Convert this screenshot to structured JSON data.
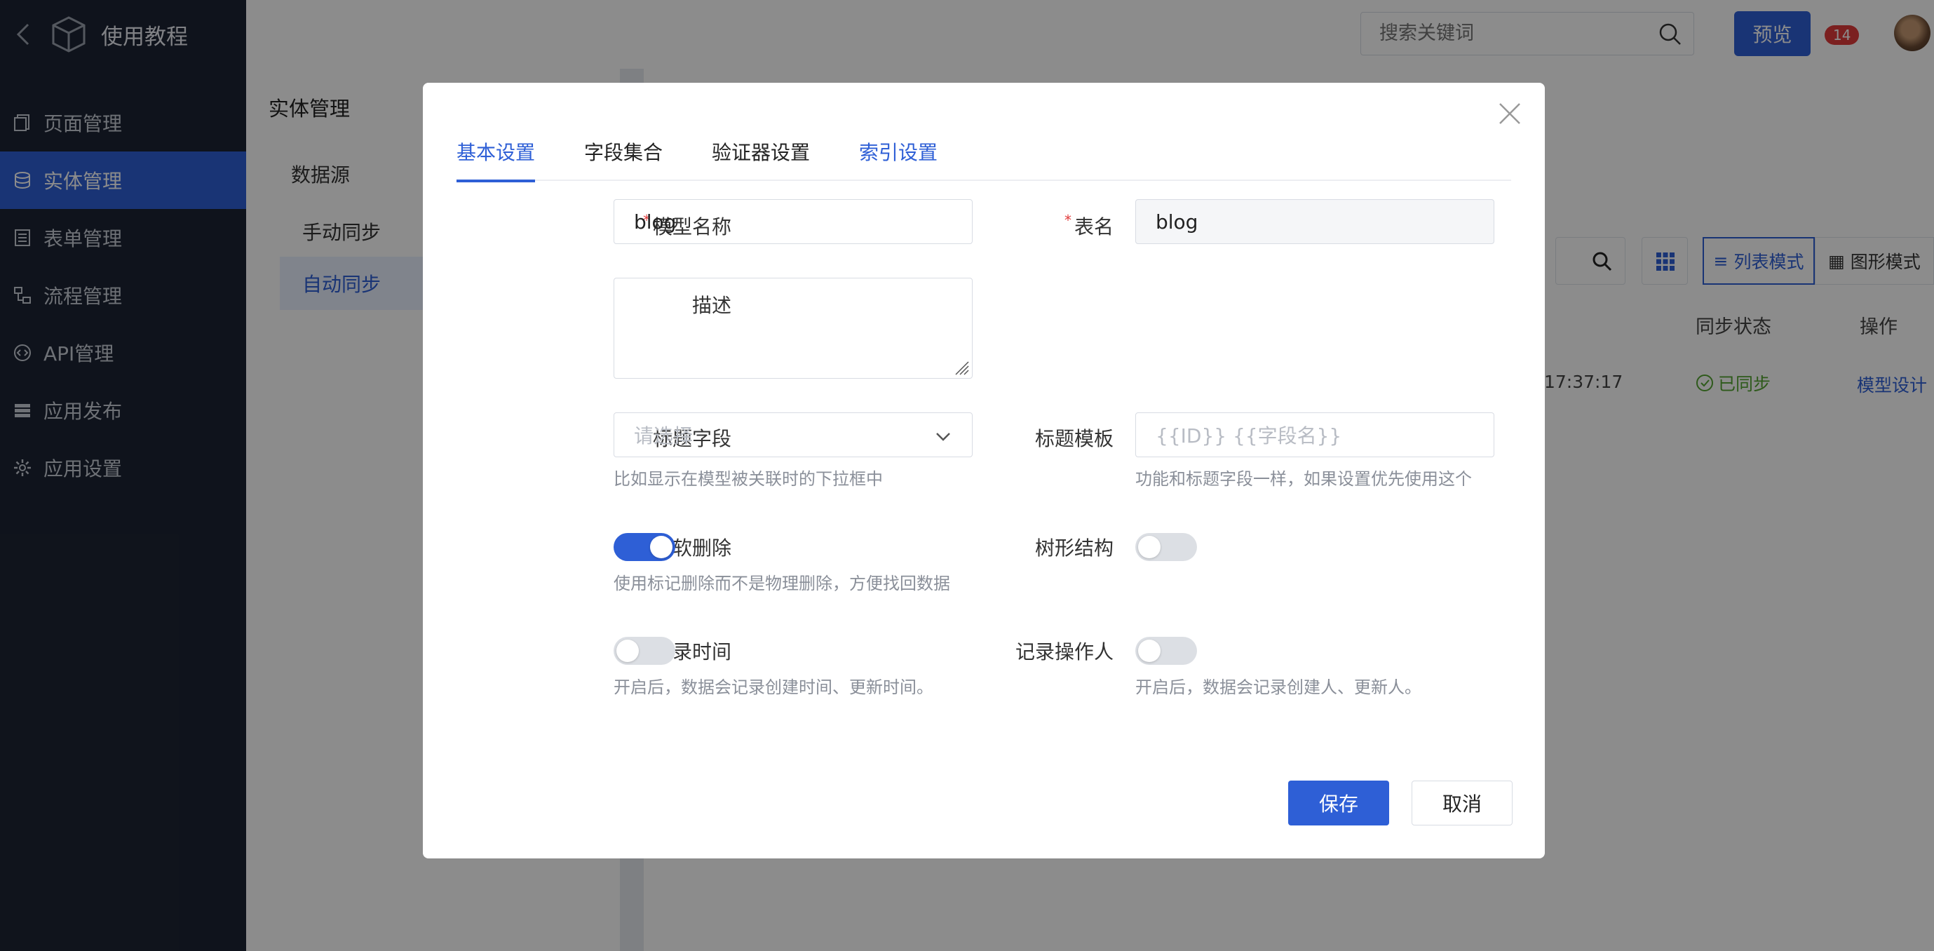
{
  "app": {
    "title": "使用教程"
  },
  "sidebar": {
    "items": [
      {
        "label": "页面管理",
        "icon": "pages-icon"
      },
      {
        "label": "实体管理",
        "icon": "database-icon",
        "active": true
      },
      {
        "label": "表单管理",
        "icon": "form-icon"
      },
      {
        "label": "流程管理",
        "icon": "flow-icon"
      },
      {
        "label": "API管理",
        "icon": "api-icon"
      },
      {
        "label": "应用发布",
        "icon": "publish-icon"
      },
      {
        "label": "应用设置",
        "icon": "gear-icon"
      }
    ]
  },
  "topbar": {
    "search_placeholder": "搜索关键词",
    "preview_label": "预览",
    "badge_count": "14"
  },
  "entity_panel": {
    "title": "实体管理",
    "datasource_label": "数据源",
    "manual_sync": "手动同步",
    "auto_sync": "自动同步"
  },
  "content": {
    "mode_list": "列表模式",
    "mode_graph": "图形模式",
    "col_sync_status": "同步状态",
    "col_action": "操作",
    "row": {
      "time": "17:37:17",
      "status": "已同步",
      "action": "模型设计"
    }
  },
  "modal": {
    "tabs": [
      "基本设置",
      "字段集合",
      "验证器设置",
      "索引设置"
    ],
    "model_name_label": "模型名称",
    "model_name_value": "blog",
    "table_name_label": "表名",
    "table_name_value": "blog",
    "desc_label": "描述",
    "title_field_label": "标题字段",
    "title_field_placeholder": "请选择",
    "title_field_hint": "比如显示在模型被关联时的下拉框中",
    "title_template_label": "标题模板",
    "title_template_placeholder": "{{ID}} {{字段名}}",
    "title_template_hint": "功能和标题字段一样，如果设置优先使用这个",
    "soft_delete_label": "软删除",
    "soft_delete_on": true,
    "soft_delete_hint": "使用标记删除而不是物理删除，方便找回数据",
    "tree_label": "树形结构",
    "tree_on": false,
    "record_time_label": "记录时间",
    "record_time_on": false,
    "record_time_hint": "开启后，数据会记录创建时间、更新时间。",
    "record_operator_label": "记录操作人",
    "record_operator_on": false,
    "record_operator_hint": "开启后，数据会记录创建人、更新人。",
    "save_label": "保存",
    "cancel_label": "取消"
  },
  "colors": {
    "primary": "#2e5fd6",
    "sidebar_bg": "#1d2433",
    "success": "#55a532",
    "danger": "#e13b3b"
  }
}
